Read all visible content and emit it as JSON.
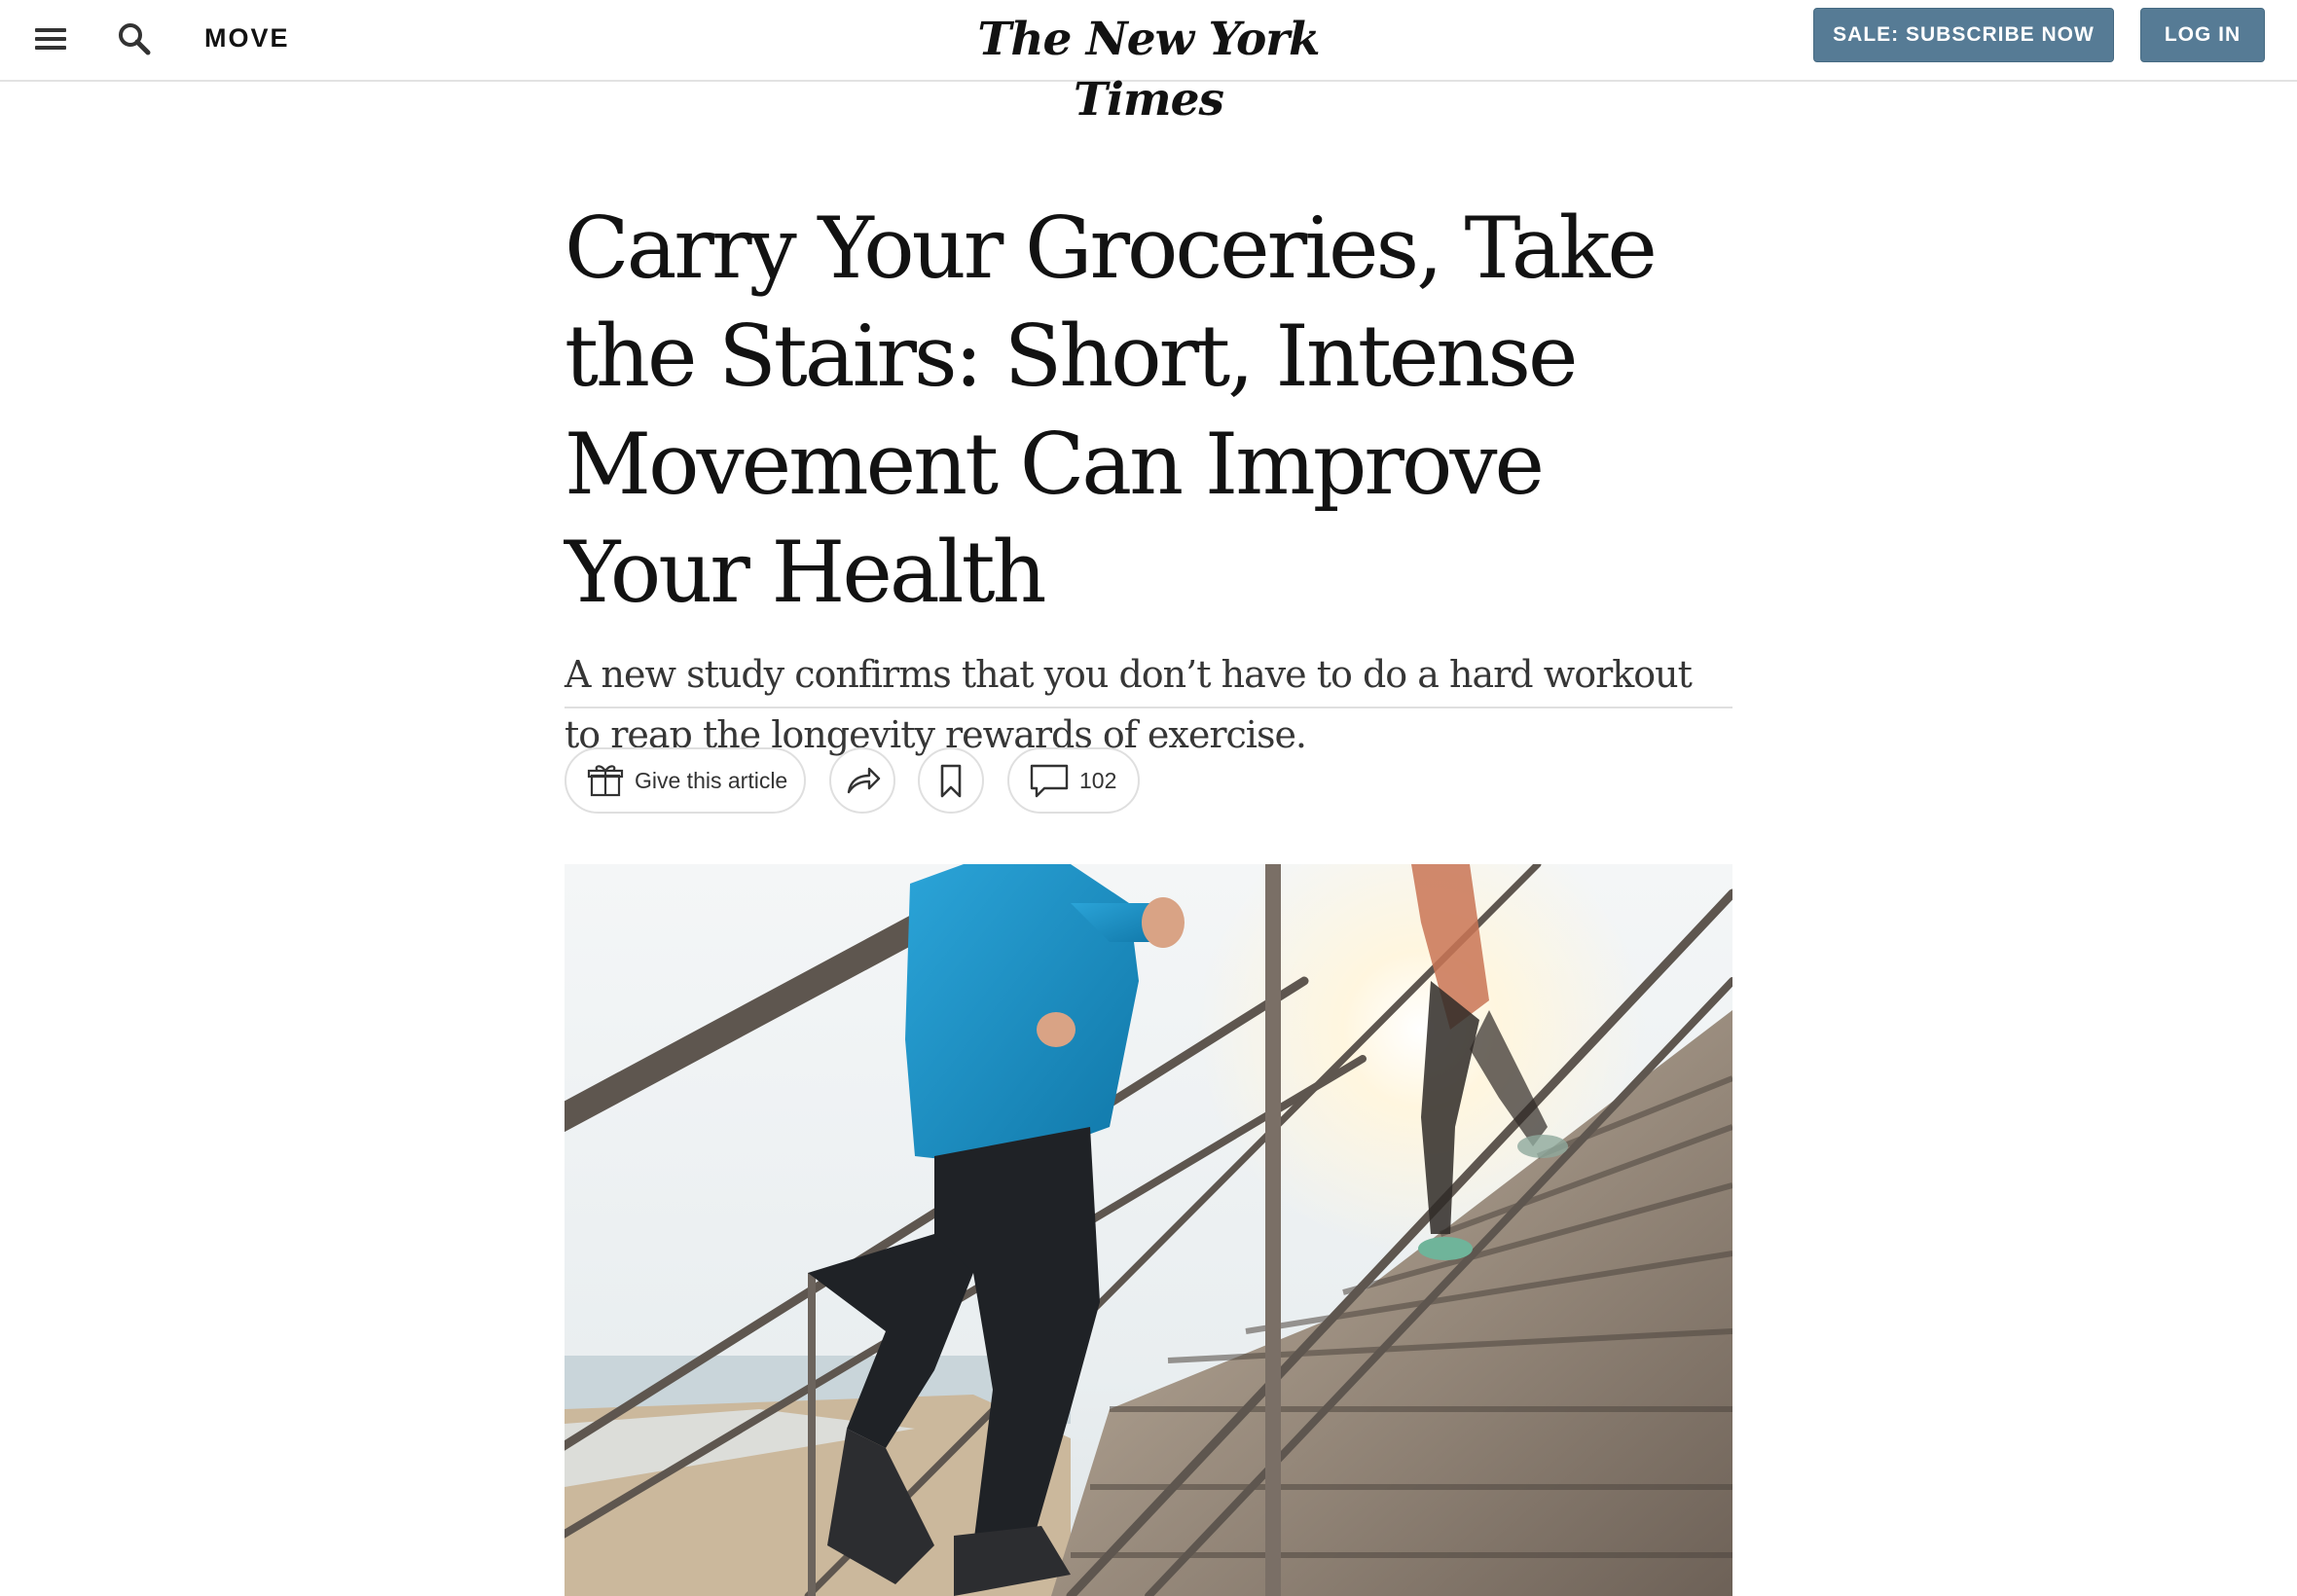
{
  "header": {
    "menu_icon": "hamburger-menu-icon",
    "search_icon": "search-icon",
    "section": "MOVE",
    "masthead": "The New York Times",
    "subscribe_label": "SALE: SUBSCRIBE NOW",
    "login_label": "LOG IN",
    "button_color": "#567b95"
  },
  "article": {
    "headline": "Carry Your Groceries, Take the Stairs: Short, Intense Movement Can Improve Your Health",
    "summary": "A new study confirms that you don’t have to do a hard workout to reap the longevity rewards of exercise."
  },
  "actions": {
    "gift_label": "Give this article",
    "gift_icon": "gift-icon",
    "share_icon": "share-arrow-icon",
    "save_icon": "bookmark-icon",
    "comments_icon": "comment-bubble-icon",
    "comments_count": "102"
  }
}
